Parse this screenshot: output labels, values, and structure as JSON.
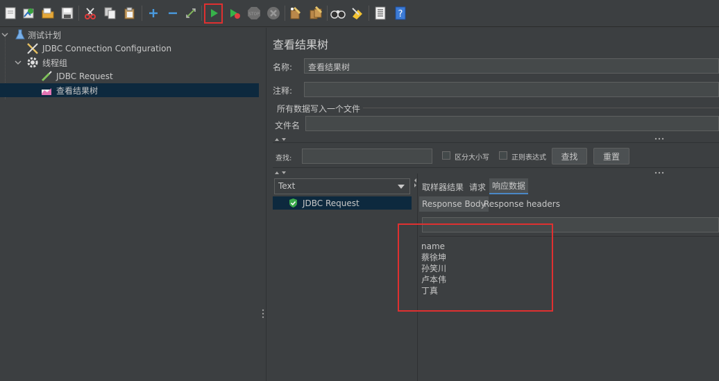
{
  "toolbar": {
    "buttons": [
      {
        "name": "new-icon"
      },
      {
        "name": "templates-icon"
      },
      {
        "name": "open-icon"
      },
      {
        "name": "save-icon"
      },
      {
        "name": "cut-icon"
      },
      {
        "name": "copy-icon"
      },
      {
        "name": "paste-icon"
      },
      {
        "name": "expand-icon"
      },
      {
        "name": "collapse-icon"
      },
      {
        "name": "toggle-icon"
      },
      {
        "name": "start-icon"
      },
      {
        "name": "start-no-pause-icon"
      },
      {
        "name": "stop-icon"
      },
      {
        "name": "shutdown-icon"
      },
      {
        "name": "clear-icon"
      },
      {
        "name": "clear-all-icon"
      },
      {
        "name": "search-icon"
      },
      {
        "name": "reset-search-icon"
      },
      {
        "name": "function-helper-icon"
      },
      {
        "name": "help-icon"
      }
    ]
  },
  "tree": {
    "items": [
      {
        "label": "测试计划",
        "icon": "flask-icon"
      },
      {
        "label": "JDBC Connection Configuration",
        "icon": "wrench-icon"
      },
      {
        "label": "线程组",
        "icon": "gear-icon"
      },
      {
        "label": "JDBC Request",
        "icon": "pipette-icon"
      },
      {
        "label": "查看结果树",
        "icon": "chart-icon"
      }
    ]
  },
  "panel": {
    "title": "查看结果树",
    "name_label": "名称:",
    "name_value": "查看结果树",
    "comment_label": "注释:",
    "comment_value": "",
    "file_group_label": "所有数据写入一个文件",
    "filename_label": "文件名",
    "filename_value": ""
  },
  "search": {
    "label": "查找:",
    "value": "",
    "case_label": "区分大小写",
    "regex_label": "正则表达式",
    "find_button": "查找",
    "reset_button": "重置"
  },
  "results": {
    "renderer": "Text",
    "items": [
      {
        "label": "JDBC Request",
        "status": "success"
      }
    ]
  },
  "tabs": {
    "items": [
      {
        "label": "取样器结果"
      },
      {
        "label": "请求"
      },
      {
        "label": "响应数据"
      }
    ],
    "active": "响应数据"
  },
  "subtabs": {
    "items": [
      {
        "label": "Response Body"
      },
      {
        "label": "Response headers"
      }
    ],
    "active": "Response Body"
  },
  "response": {
    "lines": [
      "name",
      "蔡徐坤",
      "孙笑川",
      "卢本伟",
      "丁真"
    ]
  }
}
